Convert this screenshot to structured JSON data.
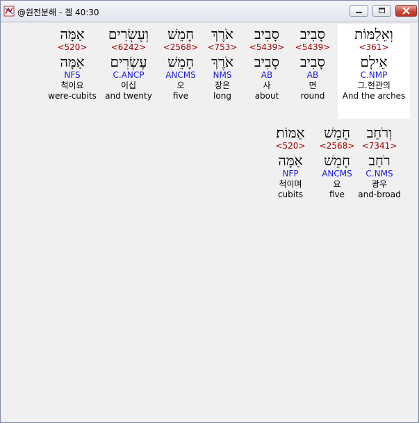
{
  "window": {
    "title": "@원전분해 - 겔 40:30",
    "buttons": {
      "minimize": "minimize",
      "maximize": "maximize",
      "close": "close"
    }
  },
  "line1": [
    {
      "surface": "וְאֵלַמּוֹת",
      "strong": "<361>",
      "lemma": "אֵילָם",
      "parse": "C.NMP",
      "kor": "그.현관의",
      "eng": "And the arches",
      "highlight": true
    },
    {
      "surface": "סָבִיב",
      "strong": "<5439>",
      "lemma": "סָבִיב",
      "parse": "AB",
      "kor": "면",
      "eng": "round"
    },
    {
      "surface": "סָבִיב",
      "strong": "<5439>",
      "lemma": "סָבִיב",
      "parse": "AB",
      "kor": "사",
      "eng": "about"
    },
    {
      "surface": "אֹרֶךְ",
      "strong": "<753>",
      "lemma": "אֹרֶךְ",
      "parse": "NMS",
      "kor": "장은",
      "eng": "long"
    },
    {
      "surface": "חָמֵשׁ",
      "strong": "<2568>",
      "lemma": "חָמֵשׁ",
      "parse": "ANCMS",
      "kor": "오",
      "eng": "five"
    },
    {
      "surface": "וְעֶשְׂרִים",
      "strong": "<6242>",
      "lemma": "עֶשְׂרִים",
      "parse": "C.ANCP",
      "kor": "이십",
      "eng": "and twenty"
    },
    {
      "surface": "אַמָּה",
      "strong": "<520>",
      "lemma": "אַמָּה",
      "parse": "NFS",
      "kor": "척이요",
      "eng": "were-cubits"
    }
  ],
  "line2": [
    {
      "surface": "וְרֹחַב",
      "strong": "<7341>",
      "lemma": "רֹחַב",
      "parse": "C.NMS",
      "kor": "광우",
      "eng": "and-broad"
    },
    {
      "surface": "חָמֵשׁ",
      "strong": "<2568>",
      "lemma": "חָמֵשׁ",
      "parse": "ANCMS",
      "kor": "요",
      "eng": "five"
    },
    {
      "surface": "אַמּוֹת׃",
      "strong": "<520>",
      "lemma": "אַמָּה",
      "parse": "NFP",
      "kor": "척이며",
      "eng": "cubits"
    }
  ],
  "colors": {
    "strong": "#a00000",
    "parse": "#1a1ad4",
    "highlight": "#ffffff"
  }
}
